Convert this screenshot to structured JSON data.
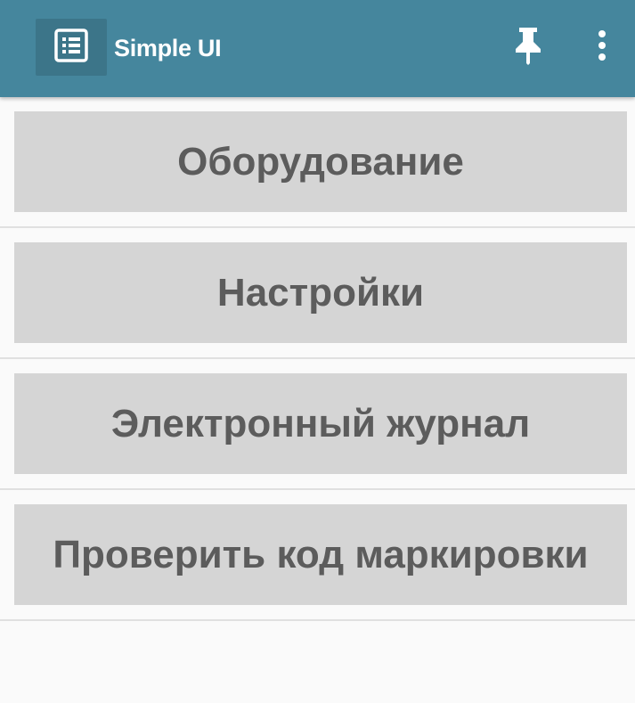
{
  "appbar": {
    "title": "Simple UI",
    "background_color": "#45869d",
    "app_icon": "list-icon",
    "actions": [
      {
        "icon": "pin-icon"
      },
      {
        "icon": "more-vert-icon"
      }
    ]
  },
  "menu": {
    "items": [
      {
        "label": "Оборудование"
      },
      {
        "label": "Настройки"
      },
      {
        "label": "Электронный журнал"
      },
      {
        "label": "Проверить код маркировки"
      }
    ],
    "button_color": "#d5d5d5",
    "text_color": "#5c5c5c"
  }
}
